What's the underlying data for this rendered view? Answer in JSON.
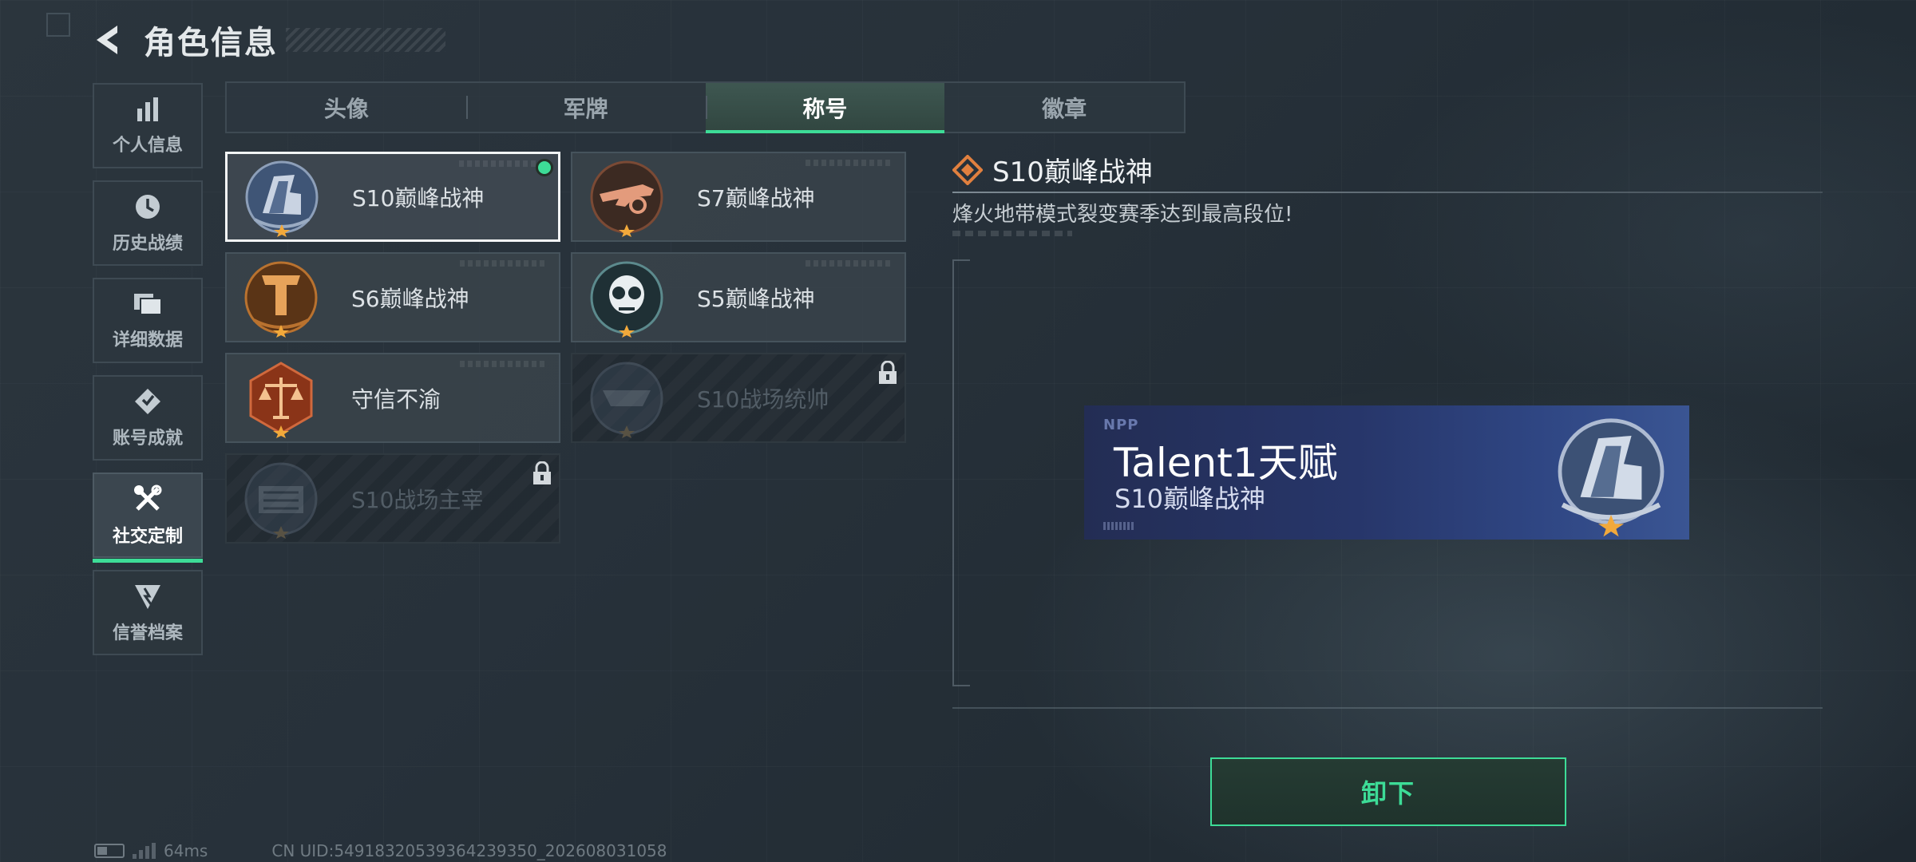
{
  "header": {
    "title": "角色信息"
  },
  "sidebar": {
    "items": [
      {
        "label": "个人信息",
        "icon": "bar-chart-icon"
      },
      {
        "label": "历史战绩",
        "icon": "clock-icon"
      },
      {
        "label": "详细数据",
        "icon": "folder-icon"
      },
      {
        "label": "账号成就",
        "icon": "achievement-icon"
      },
      {
        "label": "社交定制",
        "icon": "tools-icon",
        "active": true
      },
      {
        "label": "信誉档案",
        "icon": "shield-icon"
      }
    ]
  },
  "tabs": [
    {
      "label": "头像"
    },
    {
      "label": "军牌"
    },
    {
      "label": "称号",
      "active": true
    },
    {
      "label": "徽章"
    }
  ],
  "titles": [
    {
      "name": "S10巅峰战神",
      "state": "equipped",
      "icon": "s10-peak-emblem-icon"
    },
    {
      "name": "S7巅峰战神",
      "state": "owned",
      "icon": "s7-peak-emblem-icon"
    },
    {
      "name": "S6巅峰战神",
      "state": "owned",
      "icon": "s6-peak-emblem-icon"
    },
    {
      "name": "S5巅峰战神",
      "state": "owned",
      "icon": "s5-peak-emblem-icon"
    },
    {
      "name": "守信不渝",
      "state": "owned",
      "icon": "scales-emblem-icon"
    },
    {
      "name": "S10战场统帅",
      "state": "locked",
      "icon": "commander-emblem-icon"
    },
    {
      "name": "S10战场主宰",
      "state": "locked",
      "icon": "colosseum-emblem-icon"
    }
  ],
  "detail": {
    "title": "S10巅峰战神",
    "description": "烽火地带模式裂变赛季达到最高段位!"
  },
  "nameplate": {
    "logo": "NPP",
    "player_name": "Talent1天赋",
    "title": "S10巅峰战神"
  },
  "unequip_label": "卸下",
  "status": {
    "ping": "64ms",
    "uid": "CN UID:5491832053936423935‍0_202608031058"
  },
  "colors": {
    "accent": "#3ddc97",
    "nameplate": "#2a3a70"
  }
}
